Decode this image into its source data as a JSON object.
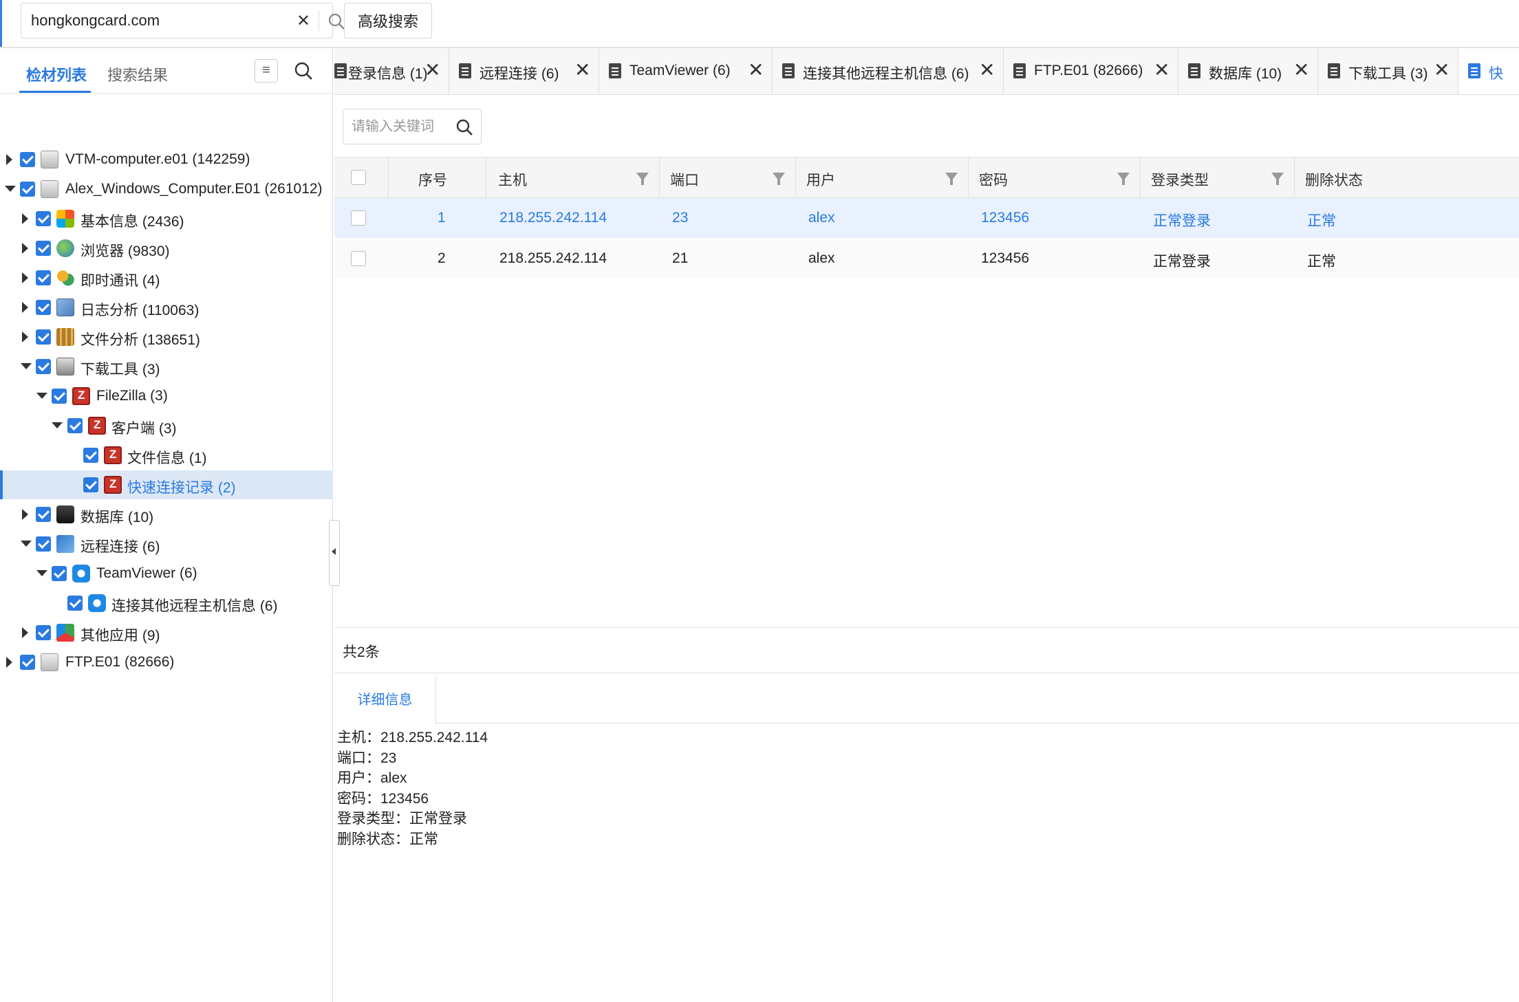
{
  "search": {
    "value": "hongkongcard.com",
    "clear_label": "✕",
    "advanced_label": "高级搜索"
  },
  "left_panel": {
    "tabs": [
      {
        "label": "检材列表"
      },
      {
        "label": "搜索结果"
      }
    ],
    "menu_icon": "≡",
    "tree": [
      {
        "label": "VTM-computer.e01 (142259)",
        "icon": "disk-icon"
      },
      {
        "label": "Alex_Windows_Computer.E01 (261012)",
        "icon": "disk-icon"
      },
      {
        "label": "基本信息 (2436)",
        "icon": "windows-icon"
      },
      {
        "label": "浏览器 (9830)",
        "icon": "globe-icon"
      },
      {
        "label": "即时通讯 (4)",
        "icon": "chat-icon"
      },
      {
        "label": "日志分析 (110063)",
        "icon": "log-icon"
      },
      {
        "label": "文件分析 (138651)",
        "icon": "files-icon"
      },
      {
        "label": "下载工具 (3)",
        "icon": "download-icon"
      },
      {
        "label": "FileZilla (3)",
        "icon": "filezilla-icon"
      },
      {
        "label": "客户端 (3)",
        "icon": "filezilla-icon"
      },
      {
        "label": "文件信息 (1)",
        "icon": "filezilla-icon"
      },
      {
        "label": "快速连接记录 (2)",
        "icon": "filezilla-icon"
      },
      {
        "label": "数据库 (10)",
        "icon": "database-icon"
      },
      {
        "label": "远程连接 (6)",
        "icon": "remote-icon"
      },
      {
        "label": "TeamViewer (6)",
        "icon": "teamviewer-icon"
      },
      {
        "label": "连接其他远程主机信息 (6)",
        "icon": "teamviewer-icon"
      },
      {
        "label": "其他应用 (9)",
        "icon": "apps-icon"
      },
      {
        "label": "FTP.E01 (82666)",
        "icon": "disk-icon"
      }
    ]
  },
  "tabs": [
    {
      "label": "登录信息 (1)"
    },
    {
      "label": "远程连接 (6)"
    },
    {
      "label": "TeamViewer (6)"
    },
    {
      "label": "连接其他远程主机信息 (6)"
    },
    {
      "label": "FTP.E01 (82666)"
    },
    {
      "label": "数据库 (10)"
    },
    {
      "label": "下载工具 (3)"
    },
    {
      "label": "快"
    }
  ],
  "filter": {
    "placeholder": "请输入关键词"
  },
  "table": {
    "columns": [
      "序号",
      "主机",
      "端口",
      "用户",
      "密码",
      "登录类型",
      "删除状态"
    ],
    "rows": [
      {
        "idx": "1",
        "host": "218.255.242.114",
        "port": "23",
        "user": "alex",
        "password": "123456",
        "login_type": "正常登录",
        "status": "正常"
      },
      {
        "idx": "2",
        "host": "218.255.242.114",
        "port": "21",
        "user": "alex",
        "password": "123456",
        "login_type": "正常登录",
        "status": "正常"
      }
    ],
    "total": "共2条"
  },
  "detail": {
    "tab_label": "详细信息",
    "lines": [
      "主机：218.255.242.114",
      "端口：23",
      "用户：alex",
      "密码：123456",
      "登录类型：正常登录",
      "删除状态：正常"
    ]
  },
  "colors": {
    "accent": "#2a7ae2",
    "selected_row": "#e8f1fd",
    "selected_node": "#dde8f6"
  }
}
